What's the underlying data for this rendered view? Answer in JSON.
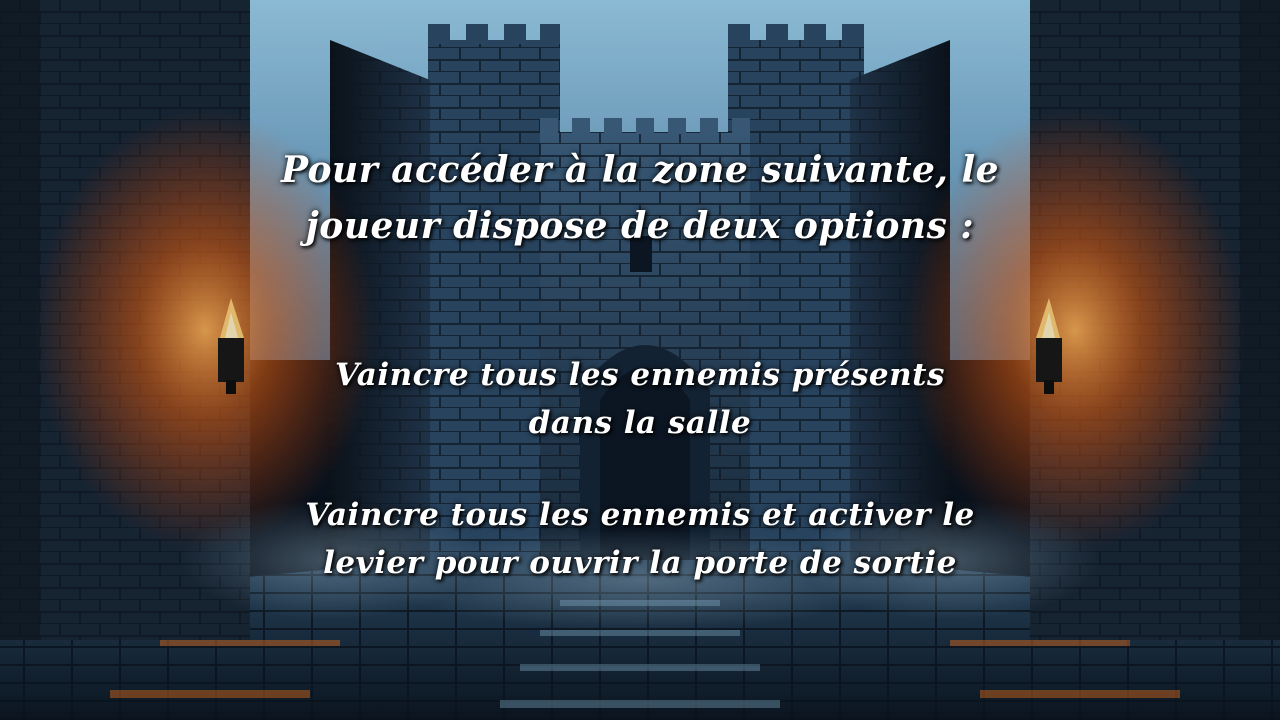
{
  "intro": {
    "line1": "Pour accéder à la zone suivante, le",
    "line2": "joueur dispose de deux options :"
  },
  "options": [
    {
      "line1": "Vaincre tous les ennemis présents",
      "line2": "dans la salle"
    },
    {
      "line1": "Vaincre tous les ennemis et activer le",
      "line2": "levier pour ouvrir la porte de sortie"
    }
  ],
  "colors": {
    "sky": "#8ec8ea",
    "stone_dark": "#1b2634",
    "stone_blue": "#2c4a66",
    "torch_glow": "#ff7a1e",
    "text": "#ffffff"
  },
  "icons": [
    "torch-icon",
    "torch-icon"
  ]
}
